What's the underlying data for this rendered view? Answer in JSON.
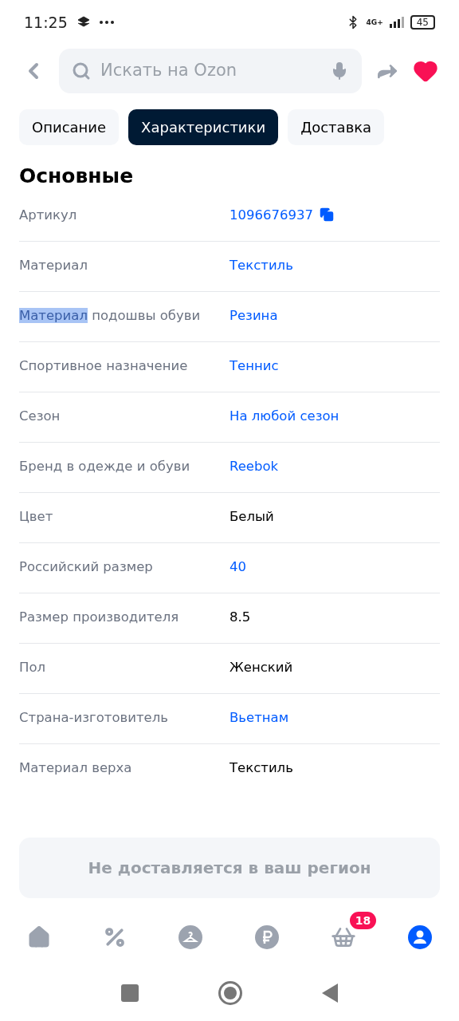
{
  "status_bar": {
    "time": "11:25",
    "battery": "45",
    "network": "4G+"
  },
  "search": {
    "placeholder": "Искать на Ozon"
  },
  "favorite": {
    "on": true
  },
  "tabs": [
    {
      "label": "Описание",
      "selected": false
    },
    {
      "label": "Характеристики",
      "selected": true
    },
    {
      "label": "Доставка",
      "selected": false
    }
  ],
  "section_title": "Основные",
  "rows": [
    {
      "label": [
        {
          "text": "Артикул",
          "selected": false
        }
      ],
      "value": "1096676937",
      "kind": "link",
      "copy": true
    },
    {
      "label": [
        {
          "text": "Материал",
          "selected": false
        }
      ],
      "value": "Текстиль",
      "kind": "link",
      "copy": false
    },
    {
      "label": [
        {
          "text": "Материал",
          "selected": true
        },
        {
          "text": " подошвы обуви",
          "selected": false
        }
      ],
      "value": "Резина",
      "kind": "link",
      "copy": false
    },
    {
      "label": [
        {
          "text": "Спортивное назначение",
          "selected": false
        }
      ],
      "value": "Теннис",
      "kind": "link",
      "copy": false
    },
    {
      "label": [
        {
          "text": "Сезон",
          "selected": false
        }
      ],
      "value": "На любой сезон",
      "kind": "link",
      "copy": false
    },
    {
      "label": [
        {
          "text": "Бренд в одежде и обуви",
          "selected": false
        }
      ],
      "value": "Reebok",
      "kind": "link",
      "copy": false
    },
    {
      "label": [
        {
          "text": "Цвет",
          "selected": false
        }
      ],
      "value": "Белый",
      "kind": "plain",
      "copy": false
    },
    {
      "label": [
        {
          "text": "Российский размер",
          "selected": false
        }
      ],
      "value": "40",
      "kind": "link",
      "copy": false
    },
    {
      "label": [
        {
          "text": "Размер производителя",
          "selected": false
        }
      ],
      "value": "8.5",
      "kind": "plain",
      "copy": false
    },
    {
      "label": [
        {
          "text": "Пол",
          "selected": false
        }
      ],
      "value": "Женский",
      "kind": "plain",
      "copy": false
    },
    {
      "label": [
        {
          "text": "Страна-изготовитель",
          "selected": false
        }
      ],
      "value": "Вьетнам",
      "kind": "link",
      "copy": false
    },
    {
      "label": [
        {
          "text": "Материал верха",
          "selected": false
        }
      ],
      "value": "Текстиль",
      "kind": "plain",
      "copy": false
    }
  ],
  "delivery_notice": "Не доставляется в ваш регион",
  "bottom_nav": [
    {
      "kind": "home",
      "selected": false
    },
    {
      "kind": "percent",
      "selected": false
    },
    {
      "kind": "hanger",
      "selected": false
    },
    {
      "kind": "ruble",
      "selected": false
    },
    {
      "kind": "cart",
      "selected": false,
      "badge": "18"
    },
    {
      "kind": "profile",
      "selected": true
    }
  ]
}
